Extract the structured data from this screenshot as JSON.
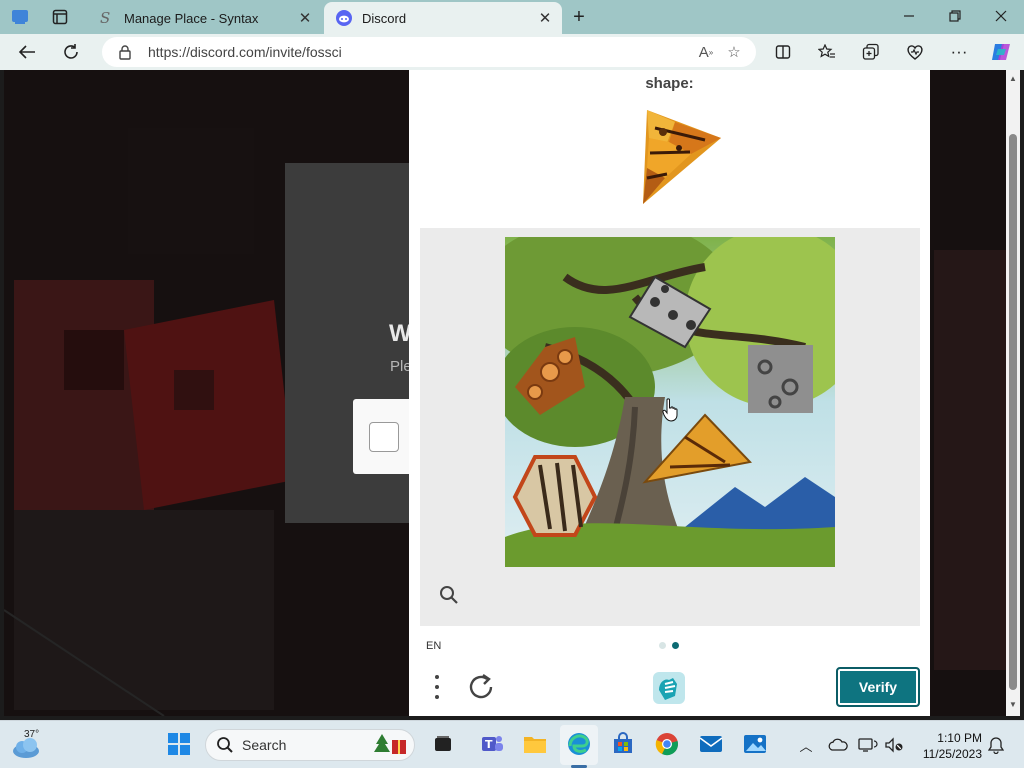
{
  "browser": {
    "tabs": [
      {
        "title": "Manage Place - Syntax",
        "active": false
      },
      {
        "title": "Discord",
        "active": true
      }
    ],
    "url": "https://discord.com/invite/fossci"
  },
  "background_page": {
    "heading_partial": "W",
    "subtext_partial": "Ple"
  },
  "captcha": {
    "prompt": "shape:",
    "language": "EN",
    "verify_label": "Verify",
    "page_dots": 2,
    "active_dot": 2
  },
  "taskbar": {
    "weather_temp": "37°",
    "search_label": "Search",
    "time": "1:10 PM",
    "date": "11/25/2023"
  },
  "colors": {
    "accent": "#0e7480",
    "tabstrip": "#9fc6c6"
  }
}
